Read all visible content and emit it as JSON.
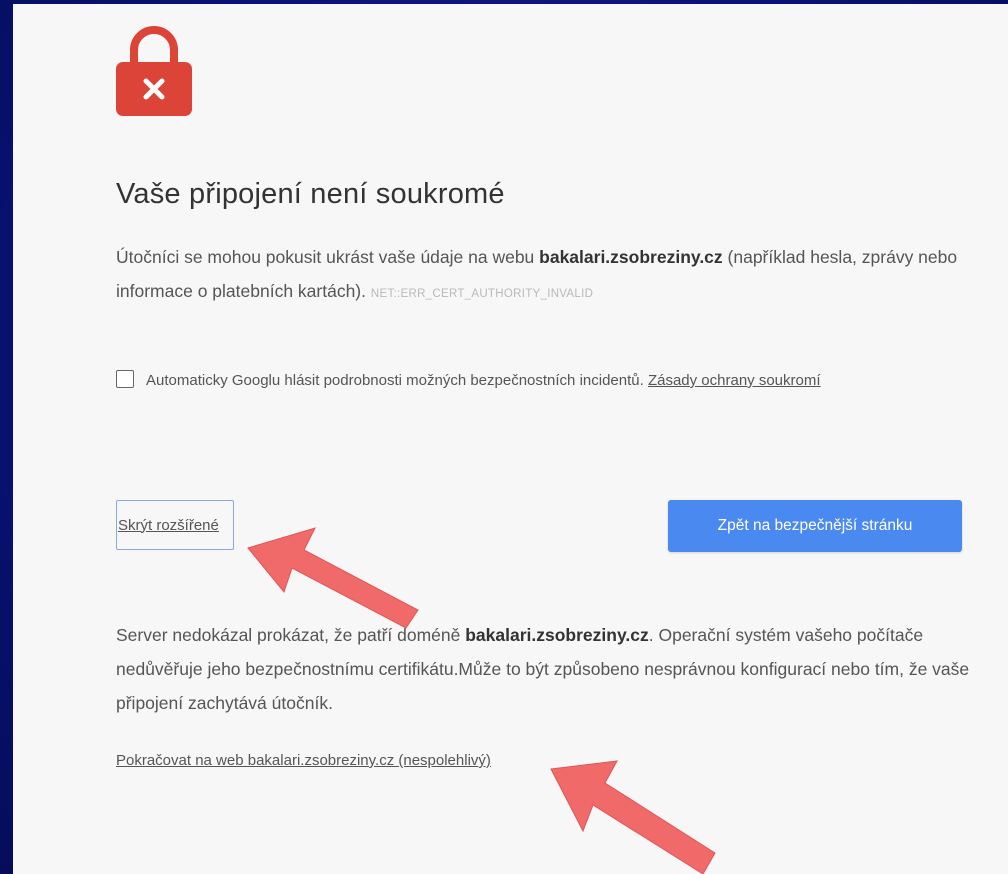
{
  "heading": "Vaše připojení není soukromé",
  "intro": {
    "prefix": "Útočníci se mohou pokusit ukrást vaše údaje na webu ",
    "domain": "bakalari.zsobreziny.cz",
    "suffix": " (například hesla, zprávy nebo informace o platebních kartách).",
    "error_code": "NET::ERR_CERT_AUTHORITY_INVALID"
  },
  "report_option": {
    "label": "Automaticky Googlu hlásit podrobnosti možných bezpečnostních incidentů. ",
    "privacy_link": "Zásady ochrany soukromí",
    "checked": false
  },
  "buttons": {
    "hide_advanced": "Skrýt rozšířené",
    "back_to_safety": "Zpět na bezpečnější stránku"
  },
  "details": {
    "prefix": "Server nedokázal prokázat, že patří doméně ",
    "domain": "bakalari.zsobreziny.cz",
    "suffix": ". Operační systém vašeho počítače nedůvěřuje jeho bezpečnostnímu certifikátu.Může to být způsobeno nesprávnou konfigurací nebo tím, že vaše připojení zachytává útočník."
  },
  "proceed_link": "Pokračovat na web bakalari.zsobreziny.cz (nespolehlivý)",
  "colors": {
    "lock_red": "#db4437",
    "primary_button": "#4a8af0",
    "annotation_arrow": "#f06a6a",
    "slide_background": "#0a1a7a"
  },
  "icons": {
    "lock": "lock-error-icon",
    "annotation_arrows": "arrow-annotation-icon"
  }
}
